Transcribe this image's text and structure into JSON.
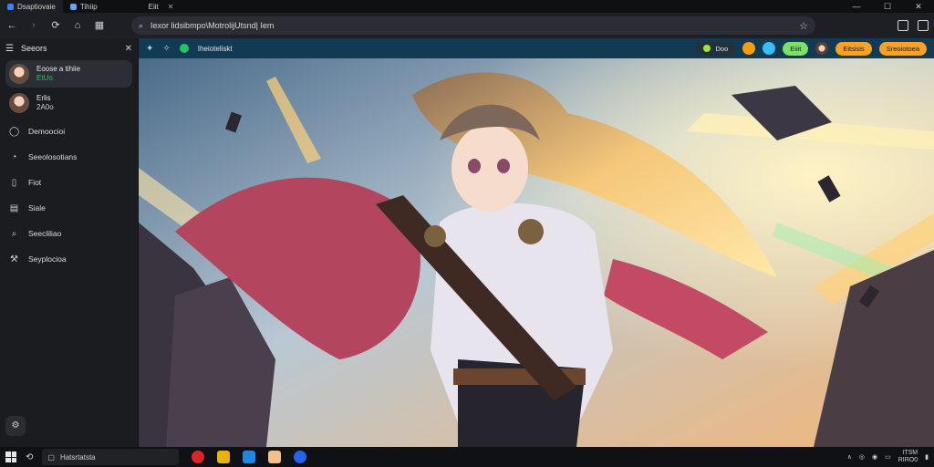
{
  "browser": {
    "tabs": [
      {
        "label": "Dsaptiovaie"
      },
      {
        "label": "Tihiip"
      },
      {
        "label": "Eiit"
      }
    ],
    "address": {
      "url": "Iexor lidsibmpo\\MotrolijUtsnd| Iem"
    }
  },
  "sidebar": {
    "title": "Seeors",
    "chats": [
      {
        "name": "Eoose a tihiie",
        "status": "EtUo"
      },
      {
        "name": "Erlis",
        "status": "2A0o"
      }
    ],
    "nav": [
      {
        "label": "Demoocioi",
        "icon": "chat-icon"
      },
      {
        "label": "Seeolosotians",
        "icon": "clock-icon"
      },
      {
        "label": "Fiot",
        "icon": "bookmark-icon"
      },
      {
        "label": "Siale",
        "icon": "doc-icon"
      },
      {
        "label": "Seecliliao",
        "icon": "search-icon"
      },
      {
        "label": "Seyplocioa",
        "icon": "wrench-icon"
      }
    ]
  },
  "site": {
    "name": "Iheioteliskt",
    "status_pill": "Doo",
    "green_pill": "Eiiit",
    "orange_pill1": "Eitsisis",
    "orange_pill2": "Sreoiotoea"
  },
  "taskbar": {
    "search": "Hatsrtatsta",
    "time": "ITSM",
    "date": "RIRO0"
  },
  "colors": {
    "accent_green": "#22c55e",
    "accent_orange": "#f5a12a",
    "site_bar": "#123a52"
  }
}
